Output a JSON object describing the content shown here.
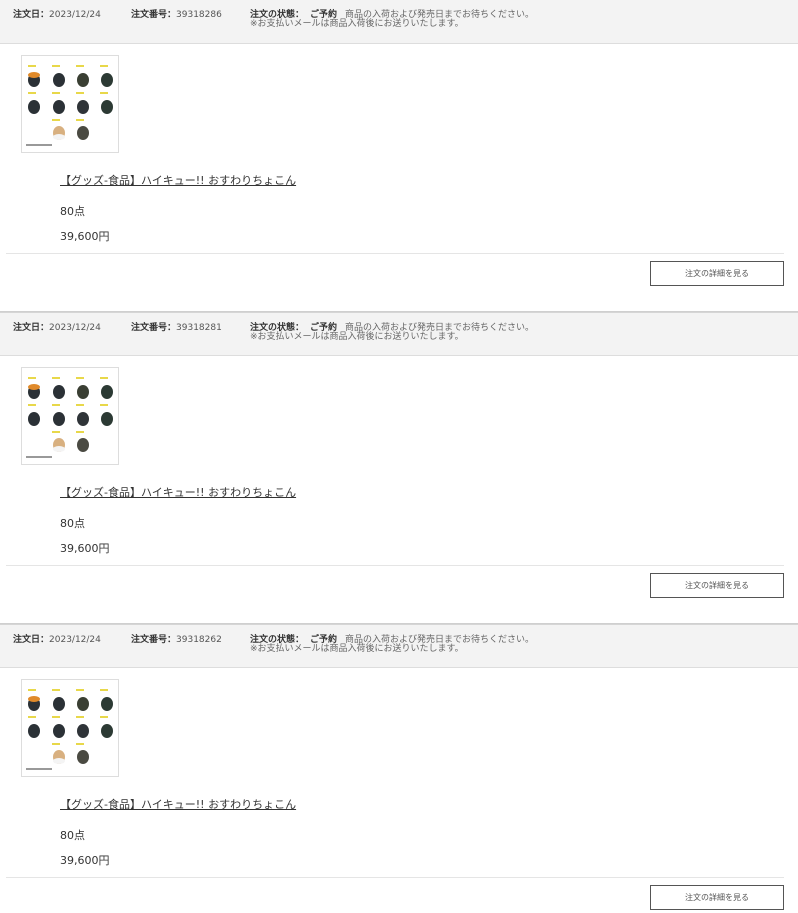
{
  "labels": {
    "order_date": "注文日：",
    "order_number": "注文番号：",
    "order_status": "注文の状態：",
    "detail_button": "注文の詳細を見る"
  },
  "orders": [
    {
      "date": "2023/12/24",
      "number": "39318286",
      "status": "ご予約",
      "status_message": "商品の入荷および発売日までお待ちください。",
      "status_note": "※お支払いメールは商品入荷後にお送りいたします。",
      "product_name": "【グッズ-食品】ハイキュー!! おすわりちょこん",
      "quantity": "80点",
      "price": "39,600円"
    },
    {
      "date": "2023/12/24",
      "number": "39318281",
      "status": "ご予約",
      "status_message": "商品の入荷および発売日までお待ちください。",
      "status_note": "※お支払いメールは商品入荷後にお送りいたします。",
      "product_name": "【グッズ-食品】ハイキュー!! おすわりちょこん",
      "quantity": "80点",
      "price": "39,600円"
    },
    {
      "date": "2023/12/24",
      "number": "39318262",
      "status": "ご予約",
      "status_message": "商品の入荷および発売日までお待ちください。",
      "status_note": "※お支払いメールは商品入荷後にお送りいたします。",
      "product_name": "【グッズ-食品】ハイキュー!! おすわりちょこん",
      "quantity": "80点",
      "price": "39,600円"
    }
  ]
}
